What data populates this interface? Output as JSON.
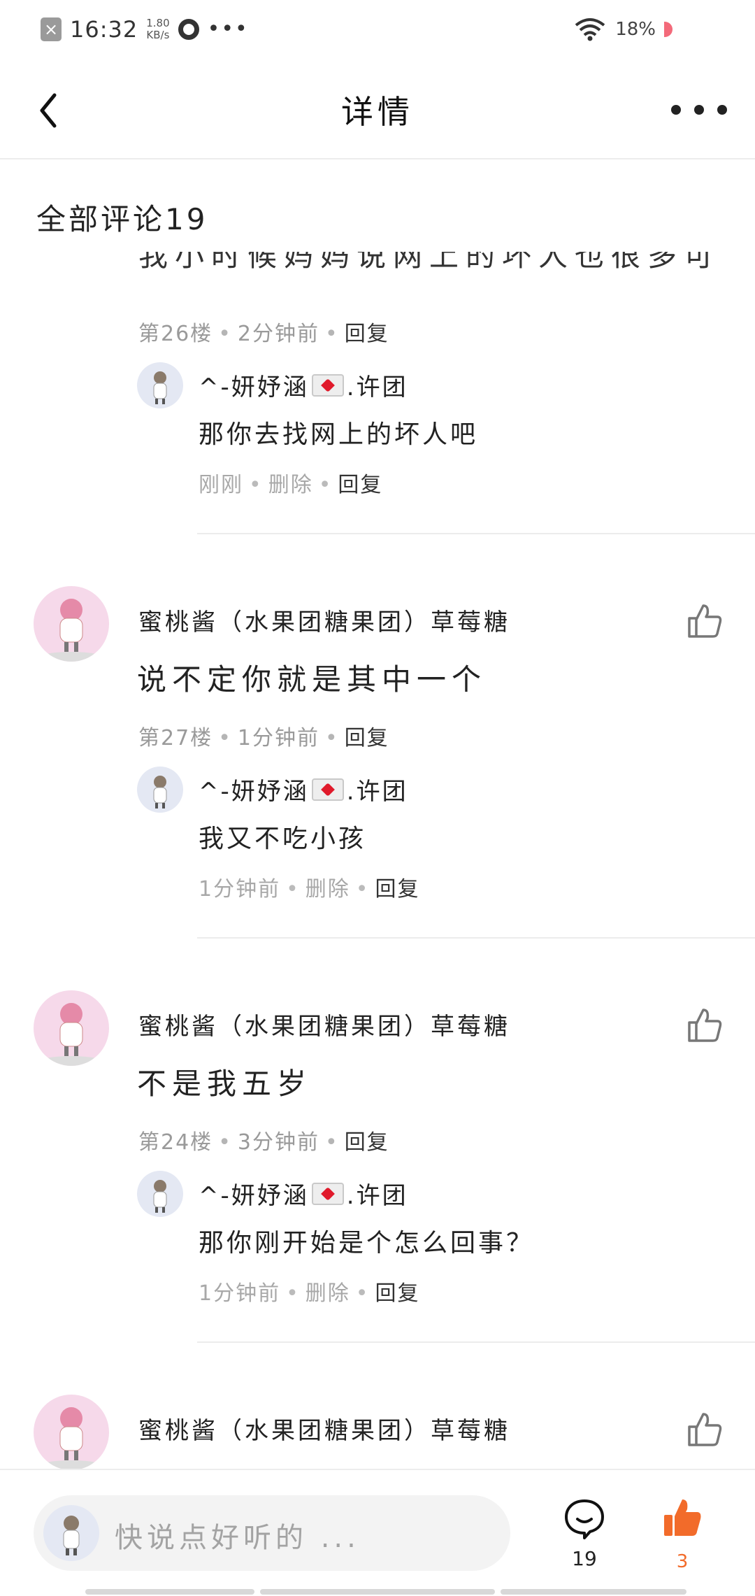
{
  "status_bar": {
    "time": "16:32",
    "speed_value": "1.80",
    "speed_unit": "KB/s",
    "more": "•••",
    "battery": "18%"
  },
  "nav": {
    "title": "详情"
  },
  "comments_header": "全部评论19",
  "cut_off_text": "我小时候妈妈说网上的坏人也很多可",
  "threads": [
    {
      "floor": "第26楼",
      "time": "2分钟前",
      "reply_label": "回复",
      "reply": {
        "name_prefix": "^-妍妤涵",
        "name_suffix": ".许团",
        "text": "那你去找网上的坏人吧",
        "time": "刚刚",
        "delete_label": "删除",
        "reply_label": "回复"
      }
    },
    {
      "user": "蜜桃酱（水果团糖果团）草莓糖",
      "content": "说不定你就是其中一个",
      "floor": "第27楼",
      "time": "1分钟前",
      "reply_label": "回复",
      "reply": {
        "name_prefix": "^-妍妤涵",
        "name_suffix": ".许团",
        "text": "我又不吃小孩",
        "time": "1分钟前",
        "delete_label": "删除",
        "reply_label": "回复"
      }
    },
    {
      "user": "蜜桃酱（水果团糖果团）草莓糖",
      "content": "不是我五岁",
      "floor": "第24楼",
      "time": "3分钟前",
      "reply_label": "回复",
      "reply": {
        "name_prefix": "^-妍妤涵",
        "name_suffix": ".许团",
        "text": "那你刚开始是个怎么回事？",
        "time": "1分钟前",
        "delete_label": "删除",
        "reply_label": "回复"
      }
    },
    {
      "user": "蜜桃酱（水果团糖果团）草莓糖"
    }
  ],
  "bottom": {
    "input_placeholder": "快说点好听的 ...",
    "comment_count": "19",
    "like_count": "3"
  },
  "icons": {
    "back": "chevron-left-icon",
    "more": "more-dots-icon",
    "like": "thumbs-up-icon",
    "comment": "comment-bubble-icon"
  },
  "colors": {
    "accent": "#f26b2a",
    "muted_text": "#9a9a9a"
  }
}
